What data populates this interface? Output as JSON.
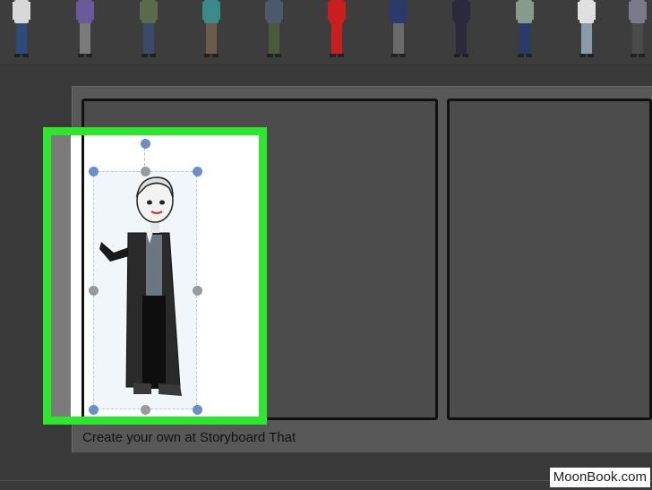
{
  "app": {
    "caption": "Create your own at Storyboard That"
  },
  "library": {
    "characters": [
      {
        "name": "character-1",
        "shirt": "#d8d8d8",
        "pants": "#2c4a7a"
      },
      {
        "name": "character-2",
        "shirt": "#6a5a9a",
        "pants": "#7a7a7a"
      },
      {
        "name": "character-3",
        "shirt": "#5a6a4a",
        "pants": "#3a4a6a"
      },
      {
        "name": "character-4",
        "shirt": "#3a8a8a",
        "pants": "#6a5a4a"
      },
      {
        "name": "character-5",
        "shirt": "#4a5a6a",
        "pants": "#4a5a3a"
      },
      {
        "name": "character-6",
        "shirt": "#c81e1e",
        "pants": "#c81e1e"
      },
      {
        "name": "character-7",
        "shirt": "#2a3a6a",
        "pants": "#6a6a6a"
      },
      {
        "name": "character-8",
        "shirt": "#2a2a3a",
        "pants": "#2a2a3a"
      },
      {
        "name": "character-9",
        "shirt": "#8a9a8a",
        "pants": "#2a3a6a"
      },
      {
        "name": "character-10",
        "shirt": "#e0e0e0",
        "pants": "#8a9aaa"
      },
      {
        "name": "character-11",
        "shirt": "#7a7a8a",
        "pants": "#4a4a4a"
      }
    ]
  },
  "watermark": "MoonBook.com",
  "colors": {
    "highlight": "#2ee62e",
    "handle_blue": "#6b8ec9",
    "handle_gray": "#9a9a9a"
  }
}
